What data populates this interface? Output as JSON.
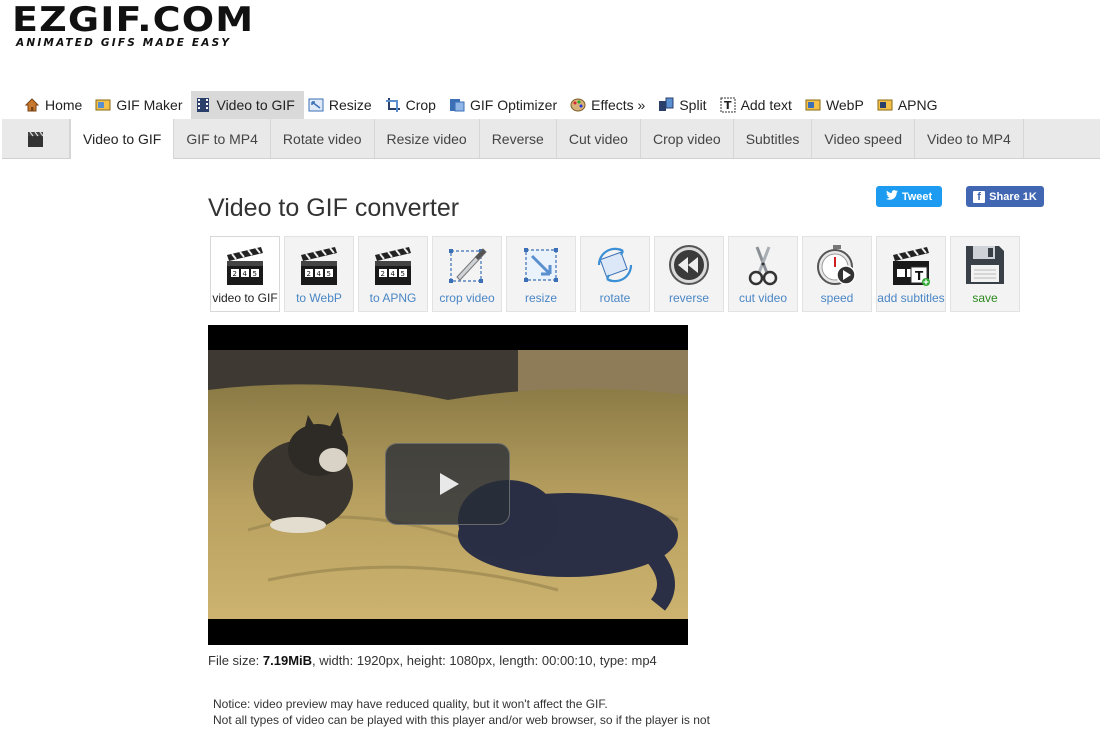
{
  "logo": {
    "main": "EZGIF.COM",
    "tagline": "ANIMATED GIFS MADE EASY"
  },
  "main_nav": [
    {
      "label": "Home",
      "icon": "home-icon"
    },
    {
      "label": "GIF Maker",
      "icon": "gif-maker-icon"
    },
    {
      "label": "Video to GIF",
      "icon": "film-icon",
      "active": true
    },
    {
      "label": "Resize",
      "icon": "resize-icon"
    },
    {
      "label": "Crop",
      "icon": "crop-icon"
    },
    {
      "label": "GIF Optimizer",
      "icon": "optimizer-icon"
    },
    {
      "label": "Effects »",
      "icon": "palette-icon"
    },
    {
      "label": "Split",
      "icon": "split-icon"
    },
    {
      "label": "Add text",
      "icon": "text-icon"
    },
    {
      "label": "WebP",
      "icon": "webp-icon"
    },
    {
      "label": "APNG",
      "icon": "apng-icon"
    }
  ],
  "sub_nav": [
    {
      "label": "Video to GIF",
      "active": true
    },
    {
      "label": "GIF to MP4"
    },
    {
      "label": "Rotate video"
    },
    {
      "label": "Resize video"
    },
    {
      "label": "Reverse"
    },
    {
      "label": "Cut video"
    },
    {
      "label": "Crop video"
    },
    {
      "label": "Subtitles"
    },
    {
      "label": "Video speed"
    },
    {
      "label": "Video to MP4"
    }
  ],
  "page_title": "Video to GIF converter",
  "social": {
    "tweet_label": "Tweet",
    "share_label": "Share 1K"
  },
  "tools": [
    {
      "label": "video to GIF",
      "icon": "clapperboard-icon",
      "active": true
    },
    {
      "label": "to WebP",
      "icon": "clapperboard-icon"
    },
    {
      "label": "to APNG",
      "icon": "clapperboard-icon"
    },
    {
      "label": "crop video",
      "icon": "crop-knife-icon"
    },
    {
      "label": "resize",
      "icon": "resize-arrow-icon"
    },
    {
      "label": "rotate",
      "icon": "rotate-icon"
    },
    {
      "label": "reverse",
      "icon": "reverse-icon"
    },
    {
      "label": "cut video",
      "icon": "scissors-icon"
    },
    {
      "label": "speed",
      "icon": "stopwatch-icon"
    },
    {
      "label": "add subtitles",
      "icon": "subtitles-icon"
    },
    {
      "label": "save",
      "icon": "floppy-icon"
    }
  ],
  "file_info": {
    "prefix": "File size: ",
    "size": "7.19MiB",
    "rest": ", width: 1920px, height: 1080px, length: 00:00:10, type: mp4"
  },
  "notice": {
    "line1": "Notice: video preview may have reduced quality, but it won't affect the GIF.",
    "line2": "Not all types of video can be played with this player and/or web browser, so if the player is not"
  },
  "colors": {
    "link": "#4a86c5",
    "tweet": "#1d9bf0",
    "facebook": "#4267b2",
    "save": "#2c8a1f"
  }
}
